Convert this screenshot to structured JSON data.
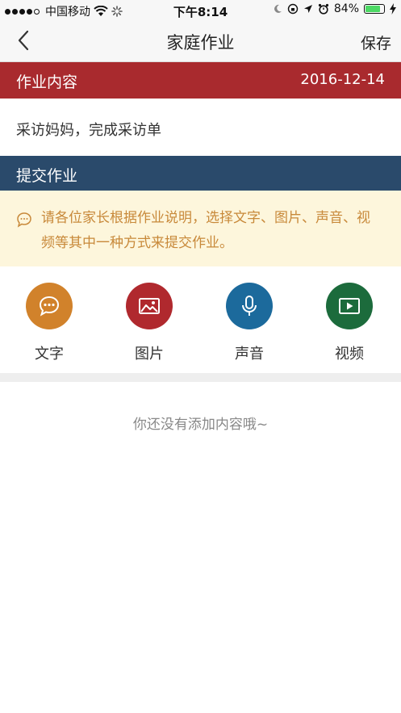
{
  "status_bar": {
    "carrier": "中国移动",
    "time": "下午8:14",
    "battery": "84%",
    "battery_level": 0.84
  },
  "nav": {
    "title": "家庭作业",
    "save_label": "保存"
  },
  "homework": {
    "section_label": "作业内容",
    "date": "2016-12-14",
    "content": "采访妈妈，完成采访单"
  },
  "submit": {
    "section_label": "提交作业",
    "notice": "请各位家长根据作业说明，选择文字、图片、声音、视频等其中一种方式来提交作业。",
    "methods": [
      {
        "label": "文字",
        "icon": "chat-icon",
        "color": "#d1822b"
      },
      {
        "label": "图片",
        "icon": "image-icon",
        "color": "#b0292e"
      },
      {
        "label": "声音",
        "icon": "microphone-icon",
        "color": "#1c6a9c"
      },
      {
        "label": "视频",
        "icon": "video-icon",
        "color": "#1c6b3c"
      }
    ]
  },
  "empty_message": "你还没有添加内容哦~"
}
